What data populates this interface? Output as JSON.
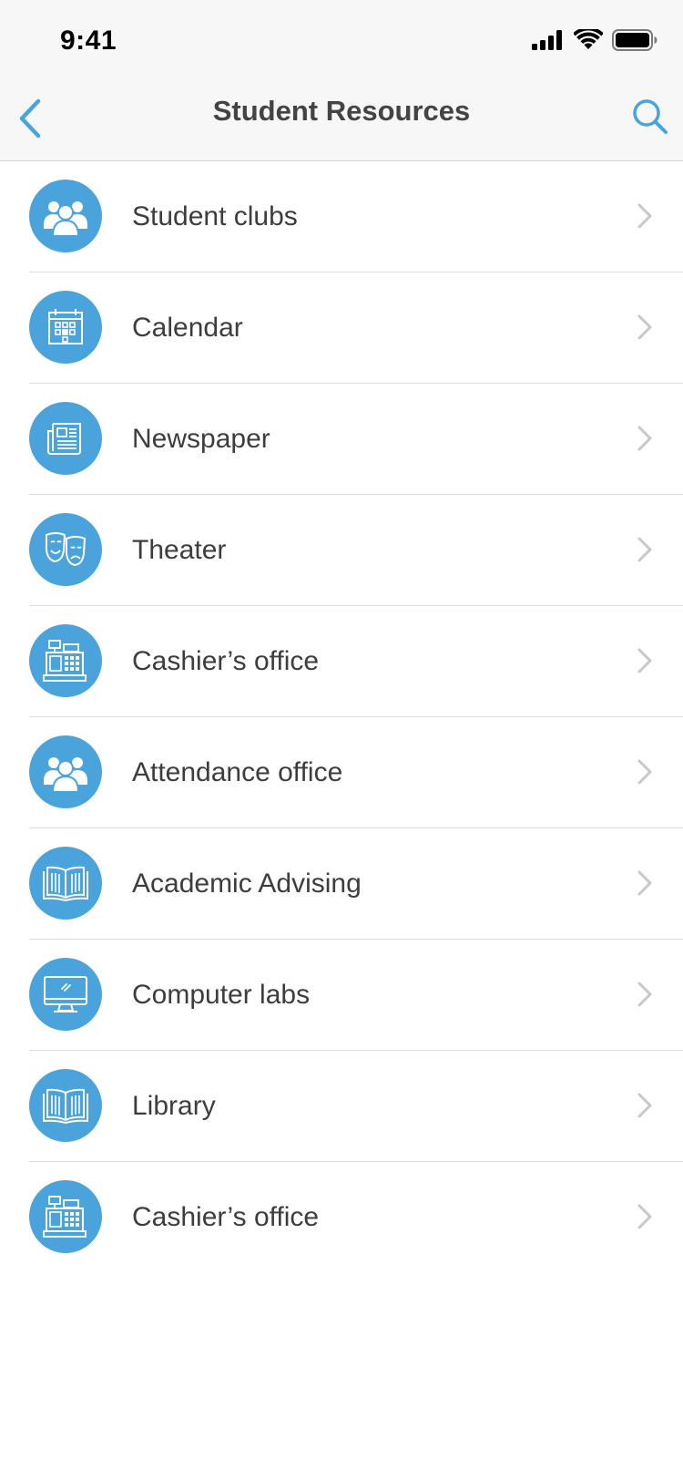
{
  "status_bar": {
    "time": "9:41",
    "icons": [
      "signal-icon",
      "wifi-icon",
      "battery-icon"
    ]
  },
  "nav": {
    "title": "Student Resources",
    "back_icon": "chevron-left-icon",
    "search_icon": "search-icon"
  },
  "colors": {
    "accent": "#4ba3dc",
    "nav_background": "#f7f7f7",
    "separator": "#dcdcdc",
    "chevron": "#c7c7cc"
  },
  "items": [
    {
      "label": "Student clubs",
      "icon": "people-icon"
    },
    {
      "label": "Calendar",
      "icon": "calendar-icon"
    },
    {
      "label": "Newspaper",
      "icon": "newspaper-icon"
    },
    {
      "label": "Theater",
      "icon": "theater-masks-icon"
    },
    {
      "label": "Cashier’s office",
      "icon": "cash-register-icon"
    },
    {
      "label": "Attendance office",
      "icon": "people-icon"
    },
    {
      "label": "Academic Advising",
      "icon": "open-book-icon"
    },
    {
      "label": "Computer labs",
      "icon": "monitor-icon"
    },
    {
      "label": "Library",
      "icon": "open-book-icon"
    },
    {
      "label": "Cashier’s office",
      "icon": "cash-register-icon"
    }
  ]
}
